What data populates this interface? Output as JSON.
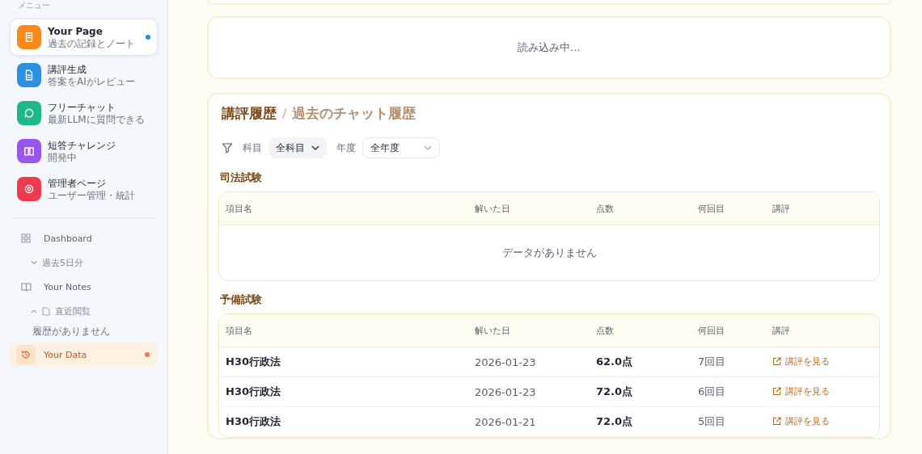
{
  "sidebar": {
    "menu_label": "メニュー",
    "menu_items": [
      {
        "title": "Your Page",
        "subtitle": "過去の記録とノート",
        "color": "#f7891d",
        "selected": true,
        "dot": true
      },
      {
        "title": "講評生成",
        "subtitle": "答案をAIがレビュー",
        "color": "#2f8fe0",
        "selected": false,
        "dot": false
      },
      {
        "title": "フリーチャット",
        "subtitle": "最新LLMに質問できる",
        "color": "#1db886",
        "selected": false,
        "dot": false
      },
      {
        "title": "短答チャレンジ",
        "subtitle": "開発中",
        "color": "#9a55ee",
        "selected": false,
        "dot": false
      },
      {
        "title": "管理者ページ",
        "subtitle": "ユーザー管理・統計",
        "color": "#ee3a4e",
        "selected": false,
        "dot": false
      }
    ],
    "nav": [
      {
        "label": "Dashboard",
        "selected": false,
        "dot": false,
        "children": [
          {
            "label": "過去5日分",
            "expanded": false
          }
        ]
      },
      {
        "label": "Your Notes",
        "selected": false,
        "dot": false,
        "children": [
          {
            "label": "直近閲覧",
            "expanded": true,
            "children": [
              {
                "label": "履歴がありません"
              }
            ]
          }
        ]
      },
      {
        "label": "Your Data",
        "selected": true,
        "dot": true
      }
    ]
  },
  "loading_card": {
    "text": "読み込み中..."
  },
  "history": {
    "title": "講評履歴",
    "separator": "/",
    "subtitle": "過去のチャット履歴",
    "filters": [
      {
        "label": "科目",
        "value": "全科目",
        "kind": "pill"
      },
      {
        "label": "年度",
        "value": "全年度",
        "kind": "select"
      }
    ],
    "sections": [
      {
        "title": "司法試験",
        "columns": [
          "項目名",
          "解いた日",
          "点数",
          "何回目",
          "講評"
        ],
        "empty_text": "データがありません"
      },
      {
        "title": "予備試験",
        "columns": [
          "項目名",
          "解いた日",
          "点数",
          "何回目",
          "講評"
        ],
        "rows": [
          {
            "name": "H30行政法",
            "date": "2026-01-23",
            "score": "62.0点",
            "attempt": "7回目",
            "link": "講評を見る"
          },
          {
            "name": "H30行政法",
            "date": "2026-01-23",
            "score": "72.0点",
            "attempt": "6回目",
            "link": "講評を見る"
          },
          {
            "name": "H30行政法",
            "date": "2026-01-21",
            "score": "72.0点",
            "attempt": "5回目",
            "link": "講評を見る"
          }
        ]
      }
    ]
  }
}
